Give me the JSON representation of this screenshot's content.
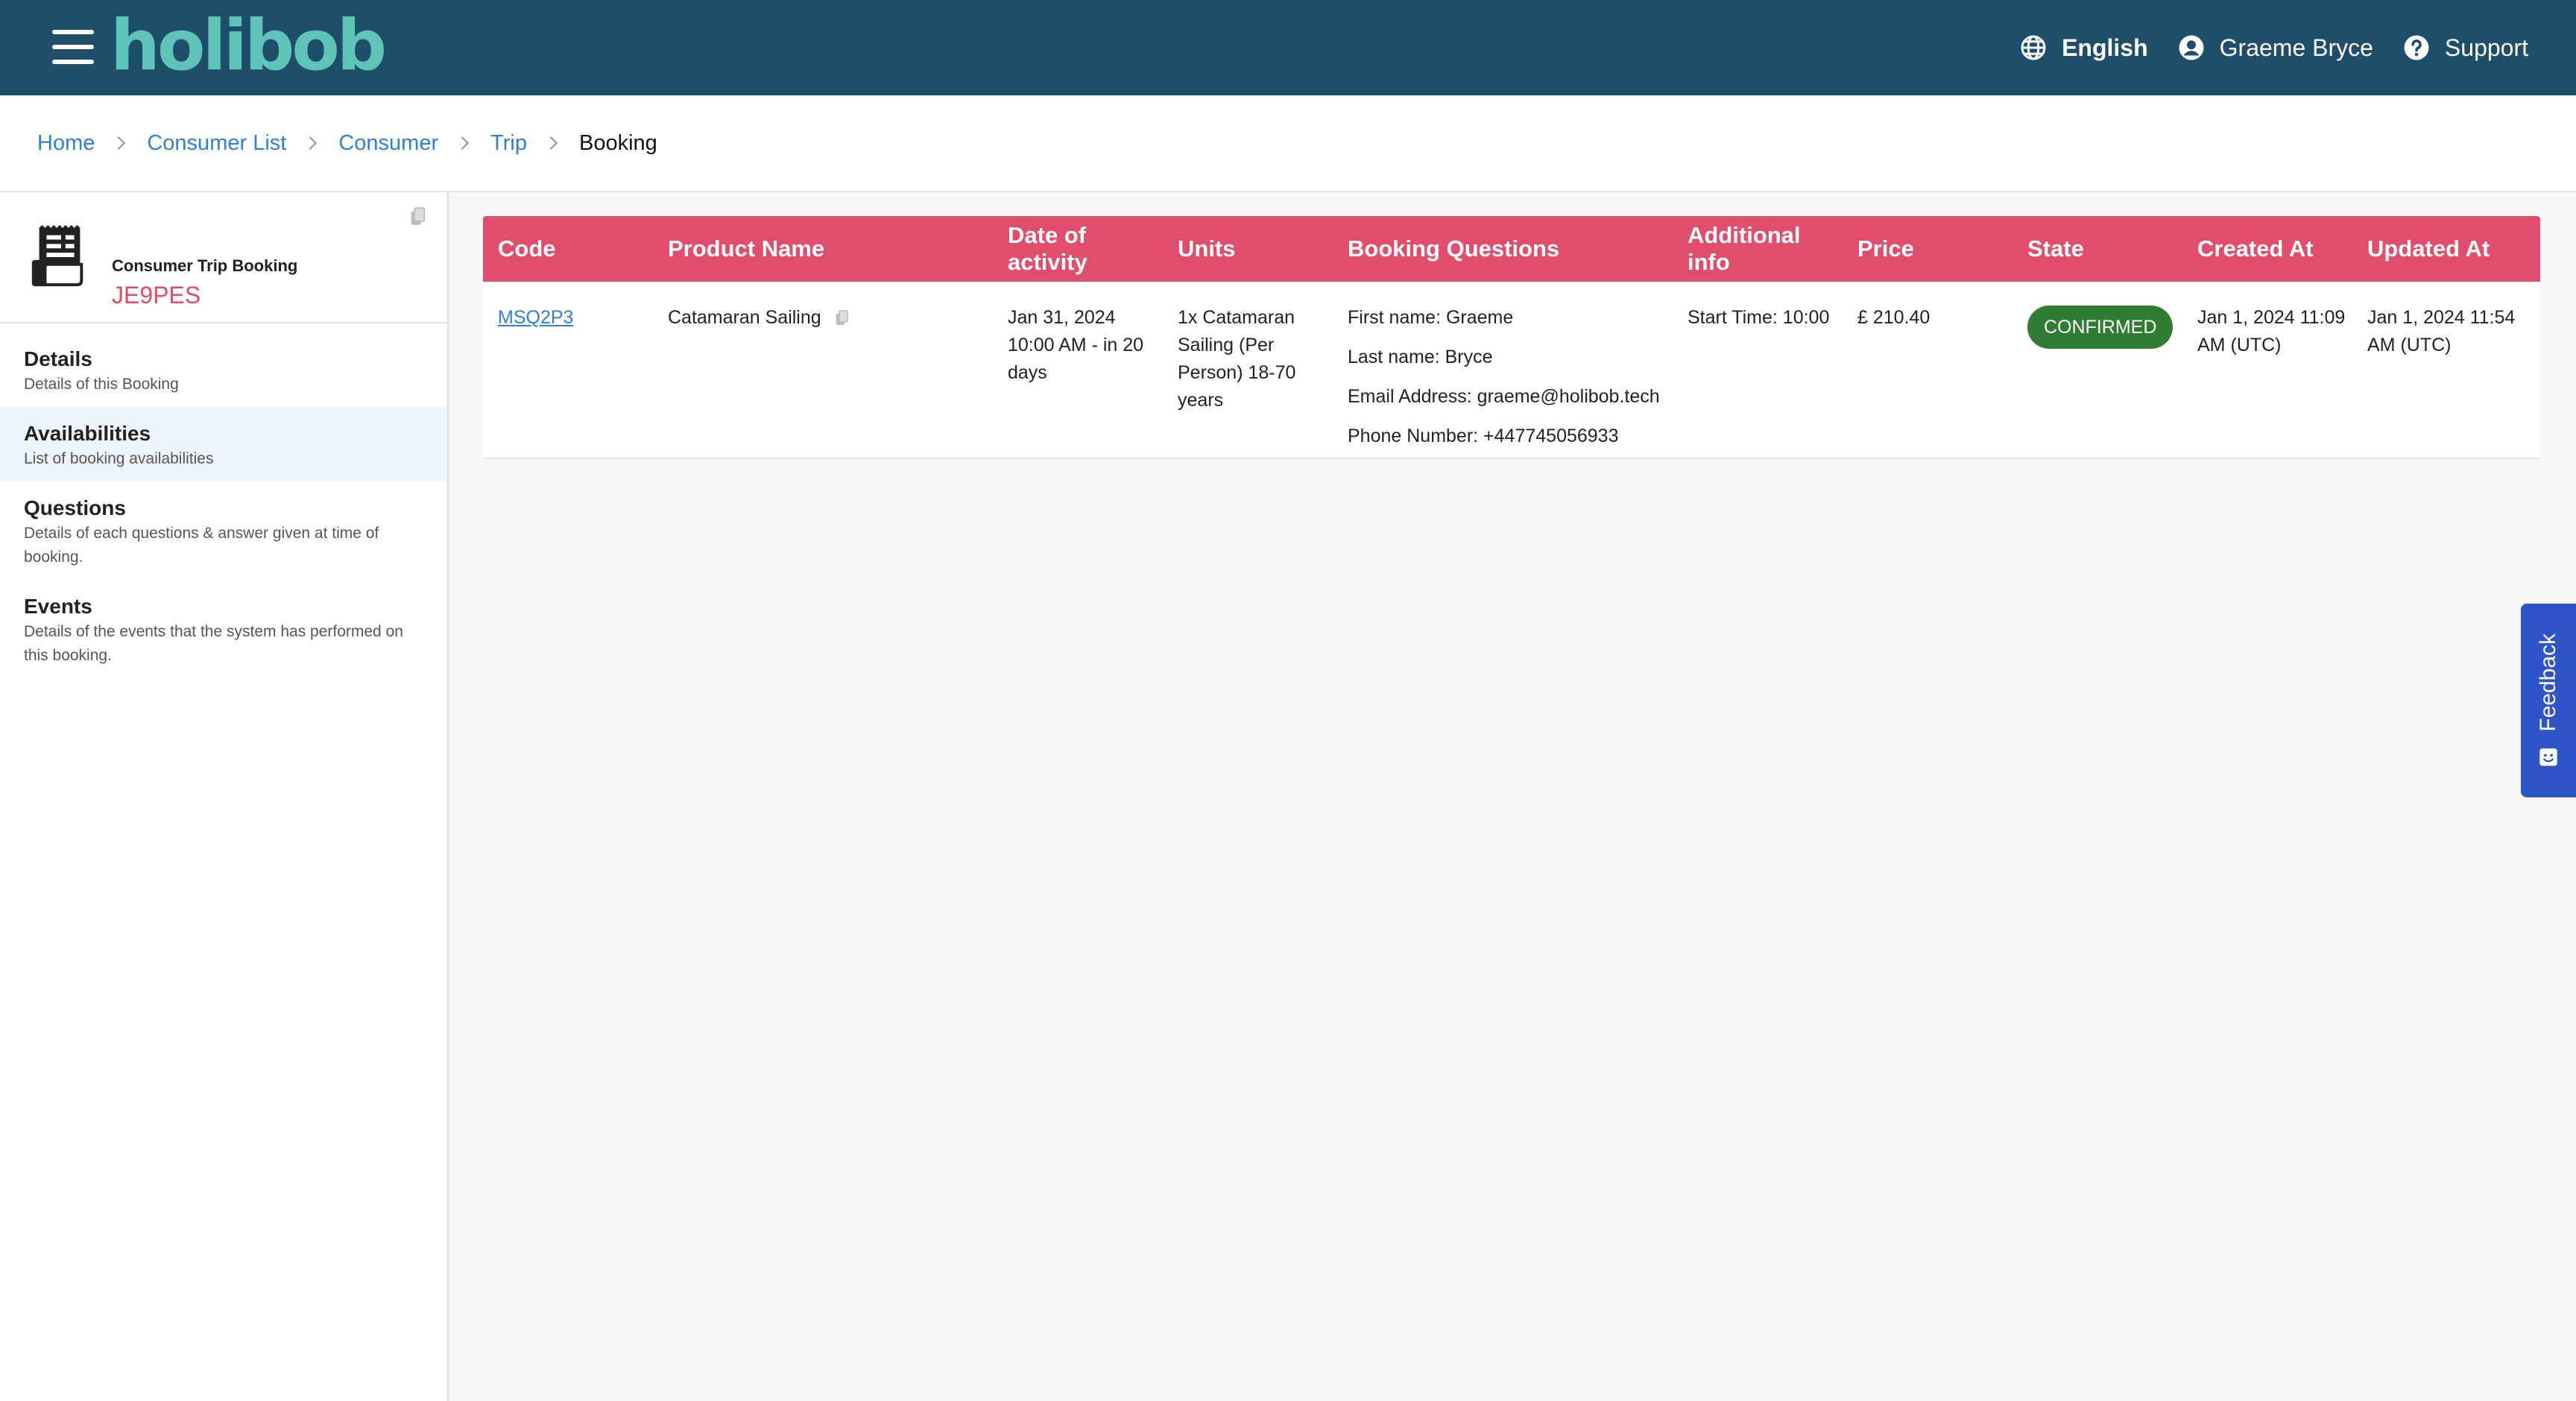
{
  "header": {
    "logo_text": "holibob",
    "language": "English",
    "user_name": "Graeme Bryce",
    "support": "Support"
  },
  "breadcrumb": [
    "Home",
    "Consumer List",
    "Consumer",
    "Trip",
    "Booking"
  ],
  "sidebar": {
    "title": "Consumer Trip Booking",
    "booking_code": "JE9PES",
    "items": [
      {
        "title": "Details",
        "desc": "Details of this Booking"
      },
      {
        "title": "Availabilities",
        "desc": "List of booking availabilities"
      },
      {
        "title": "Questions",
        "desc": "Details of each questions & answer given at time of booking."
      },
      {
        "title": "Events",
        "desc": "Details of the events that the system has performed on this booking."
      }
    ]
  },
  "table": {
    "headers": [
      "Code",
      "Product Name",
      "Date of activity",
      "Units",
      "Booking Questions",
      "Additional info",
      "Price",
      "State",
      "Created At",
      "Updated At"
    ],
    "row": {
      "code": "MSQ2P3",
      "product_name": "Catamaran Sailing",
      "date_of_activity": "Jan 31, 2024 10:00 AM - in 20 days",
      "units": "1x Catamaran Sailing (Per Person) 18-70 years",
      "booking_questions": [
        "First name: Graeme",
        "Last name: Bryce",
        "Email Address: graeme@holibob.tech",
        "Phone Number: +447745056933"
      ],
      "additional_info": "Start Time: 10:00",
      "price": "£ 210.40",
      "state": "CONFIRMED",
      "created_at": "Jan 1, 2024 11:09 AM (UTC)",
      "updated_at": "Jan 1, 2024 11:54 AM (UTC)"
    }
  },
  "feedback": {
    "label": "Feedback"
  },
  "colors": {
    "topbar": "#1e4e6a",
    "logo": "#5fc4b8",
    "table_header": "#e04d6d",
    "badge_confirmed": "#2e7d32",
    "link": "#2f7fd3",
    "booking_code": "#e04b68",
    "feedback_tab": "#2d55c9"
  }
}
